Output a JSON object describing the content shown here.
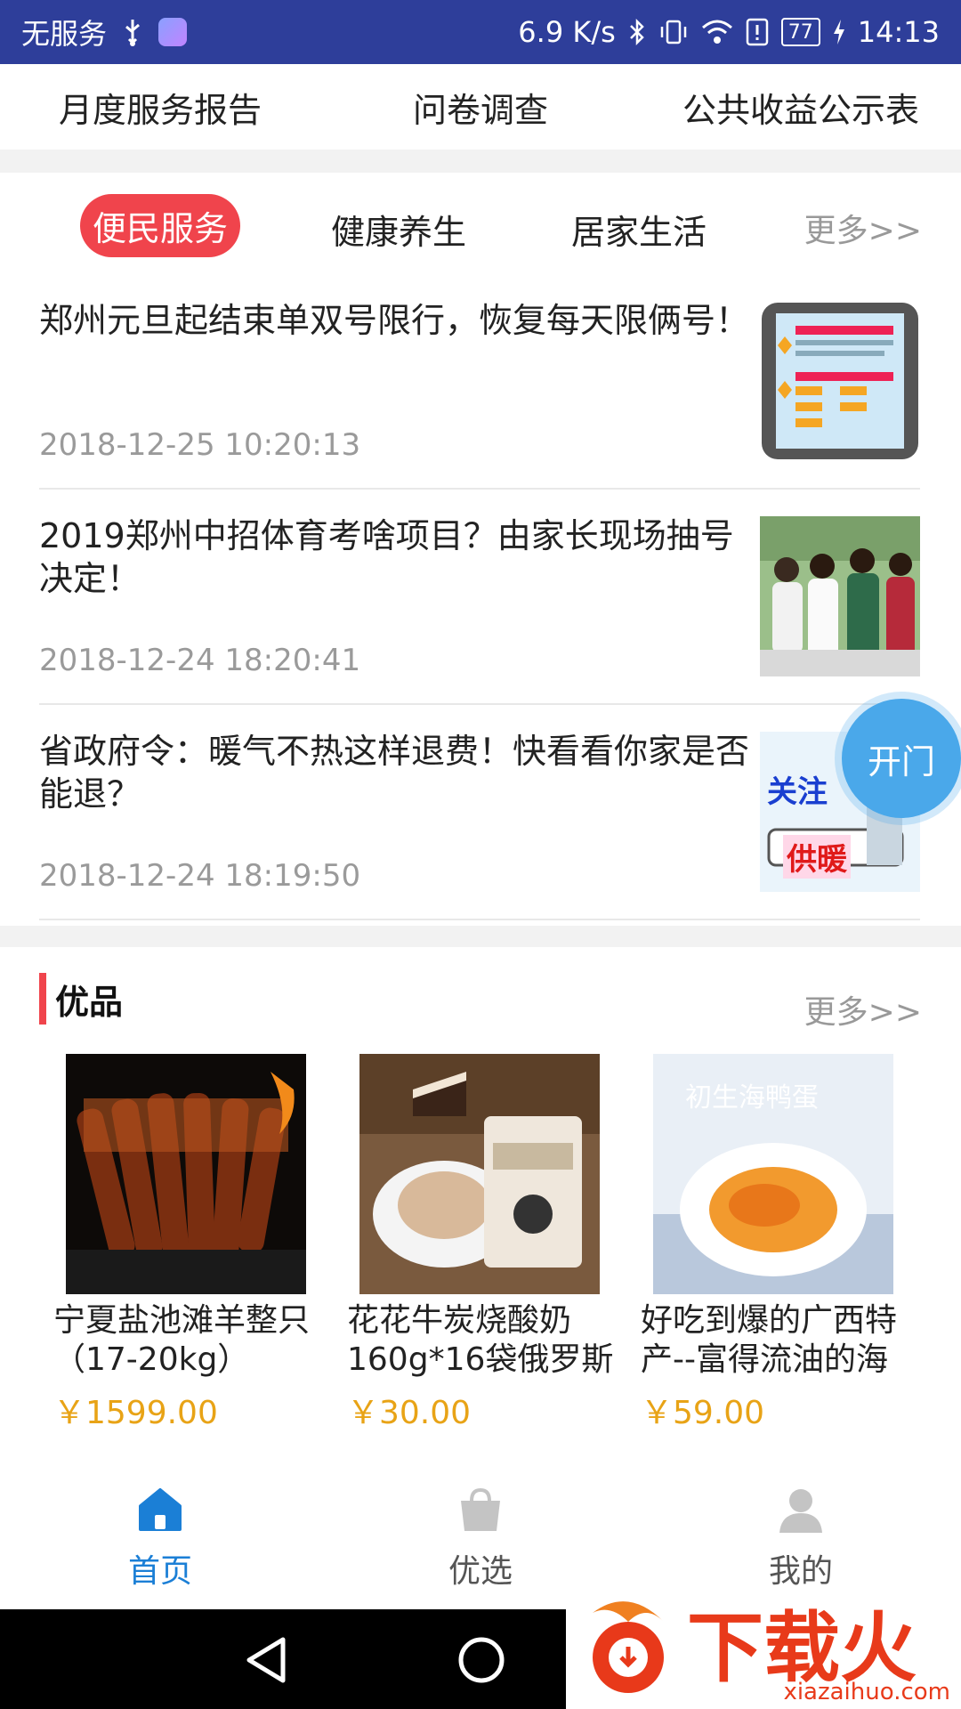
{
  "status_bar": {
    "carrier": "无服务",
    "net_speed": "6.9 K/s",
    "battery": "77",
    "time": "14:13"
  },
  "top_links": [
    "月度服务报告",
    "问卷调查",
    "公共收益公示表"
  ],
  "news": {
    "tabs": [
      "便民服务",
      "健康养生",
      "居家生活"
    ],
    "active_tab": "便民服务",
    "more": "更多>>",
    "items": [
      {
        "title": "郑州元旦起结束单双号限行，恢复每天限俩号！",
        "date": "2018-12-25 10:20:13"
      },
      {
        "title": "2019郑州中招体育考啥项目？由家长现场抽号决定！",
        "date": "2018-12-24 18:20:41"
      },
      {
        "title": "省政府令：暖气不热这样退费！快看看你家是否能退？",
        "date": "2018-12-24 18:19:50"
      }
    ],
    "thumb3_text": [
      "关注",
      "供暖"
    ]
  },
  "float_button": "开门",
  "products": {
    "title": "优品",
    "more": "更多>>",
    "items": [
      {
        "name": "宁夏盐池滩羊整只（17-20kg）",
        "price": "￥1599.00"
      },
      {
        "name": "花花牛炭烧酸奶160g*16袋俄罗斯",
        "price": "￥30.00"
      },
      {
        "name": "好吃到爆的广西特产--富得流油的海",
        "price": "￥59.00",
        "img_text": "初生海鸭蛋"
      }
    ]
  },
  "bottom_nav": [
    {
      "label": "首页",
      "icon": "home-icon",
      "active": true
    },
    {
      "label": "优选",
      "icon": "shopping-bag-icon",
      "active": false
    },
    {
      "label": "我的",
      "icon": "user-icon",
      "active": false
    }
  ],
  "watermark": {
    "text": "下载火",
    "sub": "xiazaihuo.com"
  },
  "colors": {
    "status_bar": "#2e3e9a",
    "accent_red": "#f0444c",
    "price": "#e8a316",
    "nav_active": "#1b7fd6",
    "float_button": "#4aa8ea"
  }
}
